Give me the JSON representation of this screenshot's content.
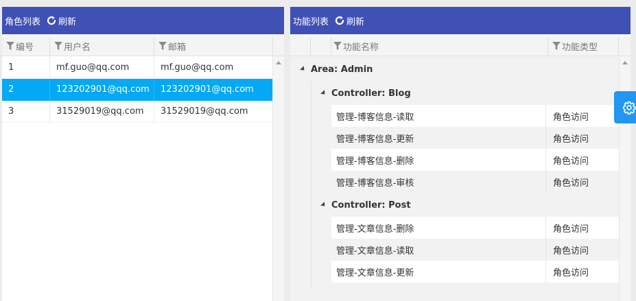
{
  "left": {
    "title": "角色列表",
    "refresh_label": "刷新",
    "columns": [
      "编号",
      "用户名",
      "邮箱"
    ],
    "rows": [
      {
        "id": "1",
        "username": "mf.guo@qq.com",
        "email": "mf.guo@qq.com"
      },
      {
        "id": "2",
        "username": "123202901@qq.com",
        "email": "123202901@qq.com"
      },
      {
        "id": "3",
        "username": "31529019@qq.com",
        "email": "31529019@qq.com"
      }
    ],
    "selected_row_index": 1
  },
  "right": {
    "title": "功能列表",
    "refresh_label": "刷新",
    "columns": [
      "功能名称",
      "功能类型"
    ],
    "area_label": "Area: Admin",
    "controllers": [
      {
        "label": "Controller: Blog",
        "rows": [
          {
            "name": "管理-博客信息-读取",
            "type": "角色访问"
          },
          {
            "name": "管理-博客信息-更新",
            "type": "角色访问"
          },
          {
            "name": "管理-博客信息-删除",
            "type": "角色访问"
          },
          {
            "name": "管理-博客信息-审核",
            "type": "角色访问"
          }
        ]
      },
      {
        "label": "Controller: Post",
        "rows": [
          {
            "name": "管理-文章信息-删除",
            "type": "角色访问"
          },
          {
            "name": "管理-文章信息-读取",
            "type": "角色访问"
          },
          {
            "name": "管理-文章信息-更新",
            "type": "角色访问"
          }
        ]
      }
    ]
  },
  "icons": {
    "refresh": "refresh-icon",
    "filter": "filter-icon",
    "expand": "tree-expanded-icon",
    "settings": "gear-icon"
  },
  "colors": {
    "header_bg": "#3f51b5",
    "selected_row": "#03a9f4",
    "settings_button": "#2196f3"
  }
}
